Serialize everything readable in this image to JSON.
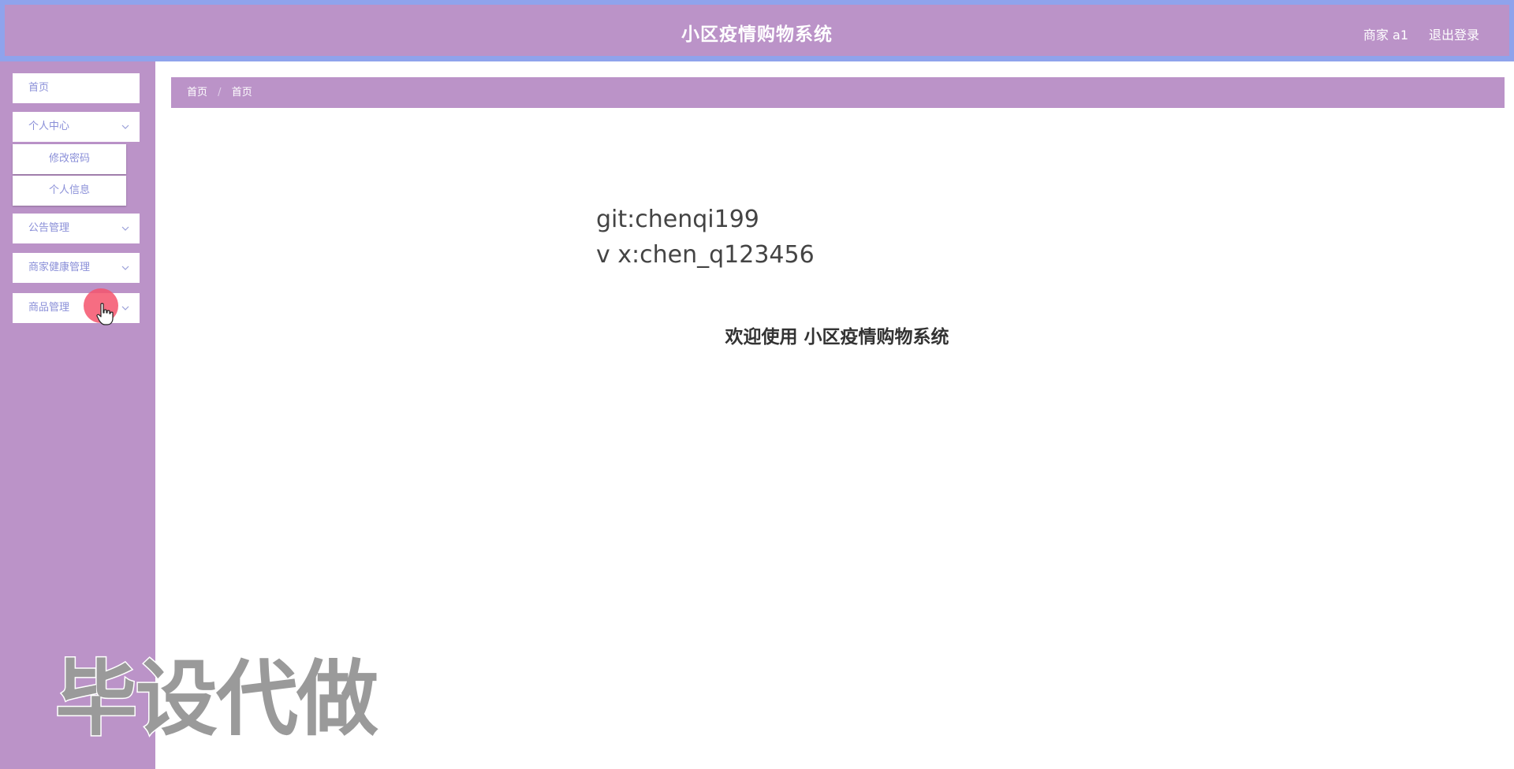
{
  "header": {
    "title": "小区疫情购物系统",
    "user_label": "商家 a1",
    "logout_label": "退出登录"
  },
  "sidebar": {
    "items": [
      {
        "label": "首页"
      },
      {
        "label": "个人中心",
        "expanded": true,
        "children": [
          {
            "label": "修改密码"
          },
          {
            "label": "个人信息"
          }
        ]
      },
      {
        "label": "公告管理"
      },
      {
        "label": "商家健康管理"
      },
      {
        "label": "商品管理"
      }
    ]
  },
  "breadcrumb": {
    "items": [
      "首页",
      "首页"
    ]
  },
  "main": {
    "git_text": "git:chenqi199",
    "vx_text": "v x:chen_q123456",
    "welcome_text": "欢迎使用 小区疫情购物系统"
  },
  "watermark": {
    "text": "毕设代做"
  },
  "colors": {
    "primary": "#bb93c8",
    "header_border": "#8fa3ec",
    "menu_text": "#8a8fd8",
    "cursor_highlight": "#f4546c"
  }
}
